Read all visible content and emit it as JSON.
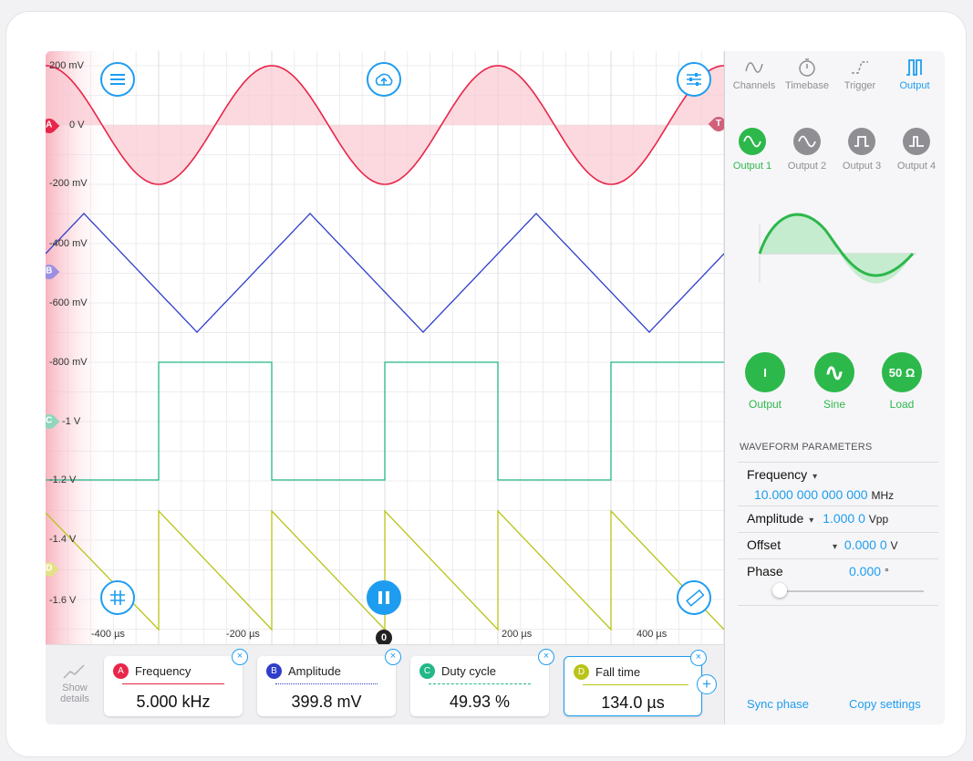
{
  "scope": {
    "y_labels": [
      "200 mV",
      "0 V",
      "-200 mV",
      "-400 mV",
      "-600 mV",
      "-800 mV",
      "-1 V",
      "-1.2 V",
      "-1.4 V",
      "-1.6 V"
    ],
    "x_labels": [
      "-400 µs",
      "-200 µs",
      "200 µs",
      "400 µs"
    ],
    "zero_marker": "0",
    "channel_markers": [
      "A",
      "B",
      "C",
      "D"
    ],
    "trigger_marker": "T",
    "colors": {
      "A": "#e8264a",
      "B": "#2f3ec8",
      "C": "#22b887",
      "D": "#b9c418",
      "accent": "#1e9df0"
    }
  },
  "toolbar_icons": {
    "menu": "menu-icon",
    "cloud": "cloud-upload-icon",
    "settings": "sliders-icon",
    "grid": "grid-icon",
    "pause": "pause-icon",
    "ruler": "ruler-icon"
  },
  "measurements": {
    "show_details": "Show details",
    "cards": [
      {
        "channel": "A",
        "title": "Frequency",
        "value": "5.000 kHz"
      },
      {
        "channel": "B",
        "title": "Amplitude",
        "value": "399.8 mV"
      },
      {
        "channel": "C",
        "title": "Duty cycle",
        "value": "49.93 %"
      },
      {
        "channel": "D",
        "title": "Fall time",
        "value": "134.0 µs"
      }
    ]
  },
  "side": {
    "tabs": [
      "Channels",
      "Timebase",
      "Trigger",
      "Output"
    ],
    "active_tab": "Output",
    "outputs": [
      "Output 1",
      "Output 2",
      "Output 3",
      "Output 4"
    ],
    "controls": [
      {
        "label": "Output",
        "symbol": "I"
      },
      {
        "label": "Sine",
        "symbol": "∿"
      },
      {
        "label": "Load",
        "symbol": "50 Ω"
      }
    ],
    "section_title": "WAVEFORM PARAMETERS",
    "params": {
      "frequency": {
        "label": "Frequency",
        "value": "10.000 000 000 000",
        "unit": "MHz"
      },
      "amplitude": {
        "label": "Amplitude",
        "value": "1.000 0",
        "unit": "Vpp"
      },
      "offset": {
        "label": "Offset",
        "value": "0.000 0",
        "unit": "V"
      },
      "phase": {
        "label": "Phase",
        "value": "0.000",
        "unit": "°"
      }
    },
    "links": {
      "sync": "Sync phase",
      "copy": "Copy settings"
    }
  }
}
